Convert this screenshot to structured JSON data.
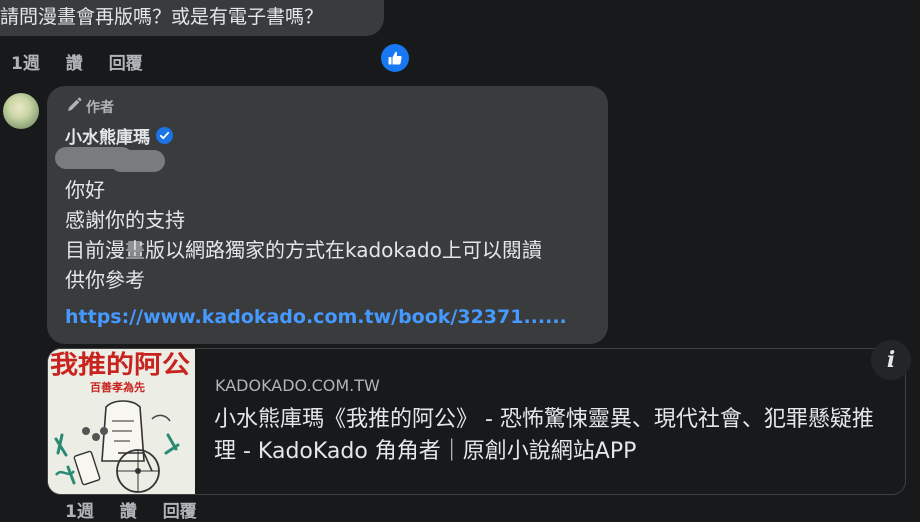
{
  "previous_comment": {
    "text": "請問漫畫會再版嗎？或是有電子書嗎？",
    "actions": {
      "time": "1週",
      "like": "讚",
      "reply": "回覆"
    },
    "reaction_icon": "thumbs-up-icon"
  },
  "reply_comment": {
    "author_badge": "作者",
    "author_badge_icon": "pencil-icon",
    "author_name": "小水熊庫瑪",
    "verified_icon": "verified-check-icon",
    "lines": [
      "你好",
      "感謝你的支持",
      "目前漫畫版以網路獨家的方式在kadokado上可以閱讀",
      "供你參考"
    ],
    "link_text": "https://www.kadokado.com.tw/book/32371......",
    "actions": {
      "time": "1週",
      "like": "讚",
      "reply": "回覆"
    }
  },
  "link_preview": {
    "domain": "KADOKADO.COM.TW",
    "title": "小水熊庫瑪《我推的阿公》 - 恐怖驚悚靈異、現代社會、犯罪懸疑推理 - KadoKado 角角者｜原創小說網站APP",
    "thumbnail_title": "我推的阿公",
    "thumbnail_subtitle": "百善孝為先",
    "info_icon": "info-icon"
  },
  "colors": {
    "background": "#18191a",
    "bubble": "#3a3b3c",
    "text_primary": "#e4e6eb",
    "text_secondary": "#b0b3b8",
    "link": "#4599ff",
    "accent": "#1877f2",
    "thumbnail_title_red": "#c8231f"
  }
}
